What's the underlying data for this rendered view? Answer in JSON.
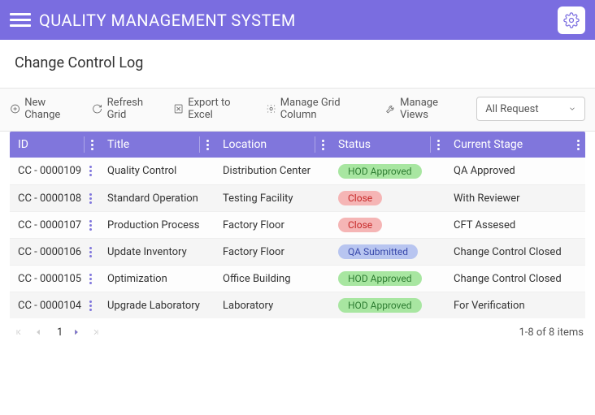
{
  "appbar": {
    "title": "QUALITY MANAGEMENT SYSTEM"
  },
  "page": {
    "title": "Change Control Log"
  },
  "toolbar": {
    "new_change": "New Change",
    "refresh": "Refresh Grid",
    "export": "Export to Excel",
    "manage_cols": "Manage Grid Column",
    "manage_views": "Manage Views"
  },
  "view_select": {
    "selected": "All Request"
  },
  "columns": {
    "id": "ID",
    "title": "Title",
    "location": "Location",
    "status": "Status",
    "stage": "Current Stage"
  },
  "rows": [
    {
      "id": "CC - 0000109",
      "title": "Quality Control",
      "location": "Distribution Center",
      "status": "HOD Approved",
      "status_style": "green",
      "stage": "QA Approved"
    },
    {
      "id": "CC - 0000108",
      "title": "Standard Operation",
      "location": "Testing Facility",
      "status": "Close",
      "status_style": "red",
      "stage": "With Reviewer"
    },
    {
      "id": "CC - 0000107",
      "title": "Production Process",
      "location": "Factory Floor",
      "status": "Close",
      "status_style": "red",
      "stage": "CFT Assesed"
    },
    {
      "id": "CC - 0000106",
      "title": "Update Inventory",
      "location": "Factory Floor",
      "status": "QA Submitted",
      "status_style": "blue",
      "stage": "Change Control Closed"
    },
    {
      "id": "CC - 0000105",
      "title": "Optimization",
      "location": "Office Building",
      "status": "HOD Approved",
      "status_style": "green",
      "stage": "Change Control Closed"
    },
    {
      "id": "CC - 0000104",
      "title": "Upgrade Laboratory",
      "location": "Laboratory",
      "status": "HOD Approved",
      "status_style": "green",
      "stage": "For Verification"
    }
  ],
  "pager": {
    "page": "1",
    "summary": "1-8 of 8 items"
  }
}
